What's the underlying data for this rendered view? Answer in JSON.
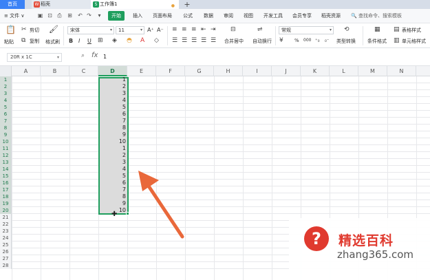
{
  "titlebar": {
    "tabs": [
      {
        "label": "首页"
      },
      {
        "label": "稻壳",
        "logo": "W"
      },
      {
        "label": "工作簿1",
        "logo": "S",
        "dot": "●"
      }
    ],
    "add_tab": "+"
  },
  "menubar": {
    "file": "≡ 文件 ∨",
    "items": [
      "开始",
      "插入",
      "页面布局",
      "公式",
      "数据",
      "审阅",
      "视图",
      "开发工具",
      "会员专享",
      "稻壳资源"
    ],
    "search": "🔍 查找命令、搜索模板"
  },
  "ribbon": {
    "paste": "粘贴",
    "cut": "剪切",
    "copy": "复制",
    "format_painter": "格式刷",
    "font_name": "宋体",
    "font_size": "11",
    "merge_center": "合并居中",
    "auto_wrap": "自动换行",
    "number_format": "常规",
    "type_convert": "类型转换",
    "cond_format": "条件格式",
    "table_style": "表格样式",
    "cell_style": "单元格样式",
    "bold": "B",
    "italic": "I",
    "underline": "U",
    "font_grow": "A⁺",
    "font_shrink": "A⁻",
    "percent": "%",
    "thousands": "000",
    "accent_color": "#1e9e5d"
  },
  "formula_bar": {
    "name_box": "20R x 1C",
    "fx": "fx",
    "value": "1"
  },
  "grid": {
    "columns": [
      "A",
      "B",
      "C",
      "D",
      "E",
      "F",
      "G",
      "H",
      "I",
      "J",
      "K",
      "L",
      "M",
      "N"
    ],
    "selected_column": "D",
    "rows": [
      "1",
      "2",
      "3",
      "4",
      "5",
      "6",
      "7",
      "8",
      "9",
      "10",
      "11",
      "12",
      "13",
      "14",
      "15",
      "16",
      "17",
      "18",
      "19",
      "20",
      "21",
      "22",
      "23",
      "24",
      "25",
      "26",
      "27",
      "28"
    ],
    "d_values": [
      "1",
      "2",
      "3",
      "4",
      "5",
      "6",
      "7",
      "8",
      "9",
      "10",
      "1",
      "2",
      "3",
      "4",
      "5",
      "6",
      "7",
      "8",
      "9",
      "10"
    ],
    "selection_color": "#1e9e5d"
  },
  "watermark": {
    "icon": "?",
    "title": "精选百科",
    "url": "zhang365.com"
  }
}
